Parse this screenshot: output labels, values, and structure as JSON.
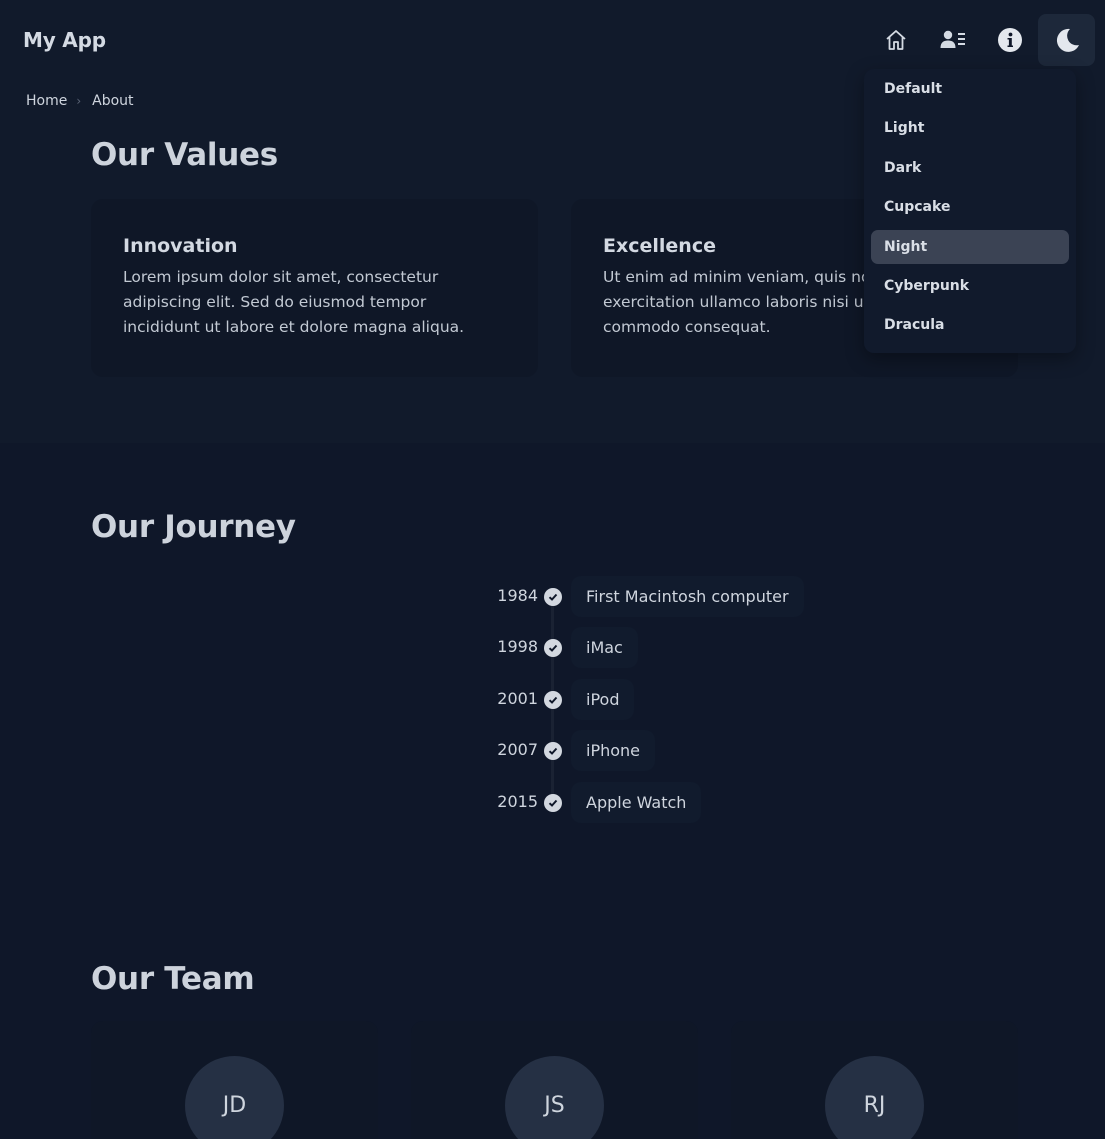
{
  "app": {
    "brand": "My App"
  },
  "nav": {
    "icons": [
      "home-icon",
      "contacts-icon",
      "info-icon",
      "moon-icon"
    ]
  },
  "theme_menu": {
    "items": [
      {
        "label": "Default",
        "active": false
      },
      {
        "label": "Light",
        "active": false
      },
      {
        "label": "Dark",
        "active": false
      },
      {
        "label": "Cupcake",
        "active": false
      },
      {
        "label": "Night",
        "active": true
      },
      {
        "label": "Cyberpunk",
        "active": false
      },
      {
        "label": "Dracula",
        "active": false
      }
    ]
  },
  "breadcrumb": {
    "items": [
      "Home",
      "About"
    ]
  },
  "values": {
    "title": "Our Values",
    "cards": [
      {
        "title": "Innovation",
        "lines": [
          "Lorem ipsum dolor sit amet, consectetur",
          "adipiscing elit. Sed do eiusmod tempor",
          "incididunt ut labore et dolore magna aliqua."
        ]
      },
      {
        "title": "Excellence",
        "lines": [
          "Ut enim ad minim veniam, quis no",
          "exercitation ullamco laboris nisi u",
          "commodo consequat."
        ]
      }
    ]
  },
  "journey": {
    "title": "Our Journey",
    "events": [
      {
        "year": "1984",
        "label": "First Macintosh computer"
      },
      {
        "year": "1998",
        "label": "iMac"
      },
      {
        "year": "2001",
        "label": "iPod"
      },
      {
        "year": "2007",
        "label": "iPhone"
      },
      {
        "year": "2015",
        "label": "Apple Watch"
      }
    ]
  },
  "team": {
    "title": "Our Team",
    "members": [
      {
        "initials": "JD"
      },
      {
        "initials": "JS"
      },
      {
        "initials": "RJ"
      }
    ]
  },
  "colors": {
    "background": "#0f1729",
    "card": "#0f1727",
    "menu_active": "#3b4354",
    "text": "#cdd3dc"
  }
}
